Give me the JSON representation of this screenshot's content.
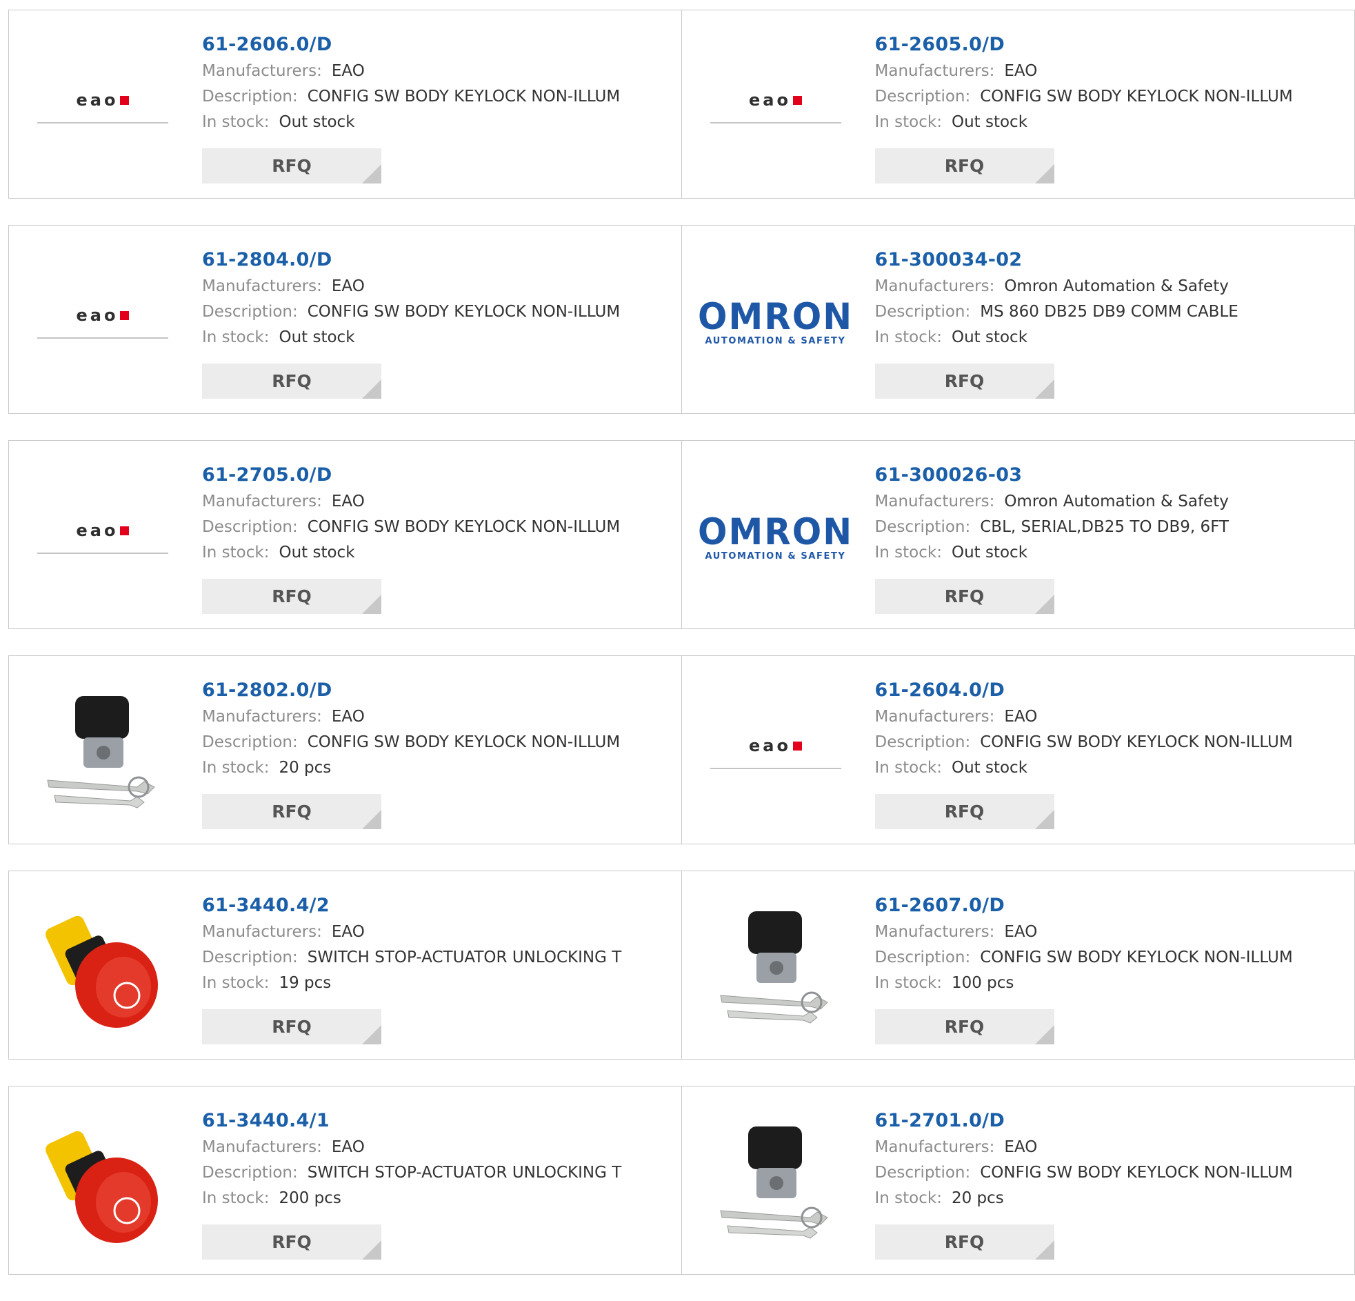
{
  "labels": {
    "manufacturer": "Manufacturers:",
    "description": "Description:",
    "stock": "In stock:",
    "rfq": "RFQ"
  },
  "colors": {
    "part_link": "#1a5fa8",
    "label": "#8c8c8c",
    "rfq_bg": "#ececec",
    "eao_red": "#e3001b",
    "omron_blue": "#1f57a7"
  },
  "products": [
    {
      "part": "61-2606.0/D",
      "manufacturer": "EAO",
      "description": "CONFIG SW BODY KEYLOCK NON-ILLUM",
      "stock": "Out stock",
      "image": "eao-logo"
    },
    {
      "part": "61-2605.0/D",
      "manufacturer": "EAO",
      "description": "CONFIG SW BODY KEYLOCK NON-ILLUM",
      "stock": "Out stock",
      "image": "eao-logo"
    },
    {
      "part": "61-2804.0/D",
      "manufacturer": "EAO",
      "description": "CONFIG SW BODY KEYLOCK NON-ILLUM",
      "stock": "Out stock",
      "image": "eao-logo"
    },
    {
      "part": "61-300034-02",
      "manufacturer": "Omron Automation & Safety",
      "description": "MS 860 DB25 DB9 COMM CABLE",
      "stock": "Out stock",
      "image": "omron-logo"
    },
    {
      "part": "61-2705.0/D",
      "manufacturer": "EAO",
      "description": "CONFIG SW BODY KEYLOCK NON-ILLUM",
      "stock": "Out stock",
      "image": "eao-logo"
    },
    {
      "part": "61-300026-03",
      "manufacturer": "Omron Automation & Safety",
      "description": "CBL, SERIAL,DB25 TO DB9, 6FT",
      "stock": "Out stock",
      "image": "omron-logo"
    },
    {
      "part": "61-2802.0/D",
      "manufacturer": "EAO",
      "description": "CONFIG SW BODY KEYLOCK NON-ILLUM",
      "stock": "20 pcs",
      "image": "keylock-photo"
    },
    {
      "part": "61-2604.0/D",
      "manufacturer": "EAO",
      "description": "CONFIG SW BODY KEYLOCK NON-ILLUM",
      "stock": "Out stock",
      "image": "eao-logo"
    },
    {
      "part": "61-3440.4/2",
      "manufacturer": "EAO",
      "description": "SWITCH STOP-ACTUATOR UNLOCKING T",
      "stock": "19 pcs",
      "image": "stop-button-photo"
    },
    {
      "part": "61-2607.0/D",
      "manufacturer": "EAO",
      "description": "CONFIG SW BODY KEYLOCK NON-ILLUM",
      "stock": "100 pcs",
      "image": "keylock-photo"
    },
    {
      "part": "61-3440.4/1",
      "manufacturer": "EAO",
      "description": "SWITCH STOP-ACTUATOR UNLOCKING T",
      "stock": "200 pcs",
      "image": "stop-button-photo"
    },
    {
      "part": "61-2701.0/D",
      "manufacturer": "EAO",
      "description": "CONFIG SW BODY KEYLOCK NON-ILLUM",
      "stock": "20 pcs",
      "image": "keylock-photo"
    }
  ],
  "logos": {
    "eao": "eao",
    "omron": "OMRON",
    "omron_sub": "AUTOMATION & SAFETY"
  }
}
